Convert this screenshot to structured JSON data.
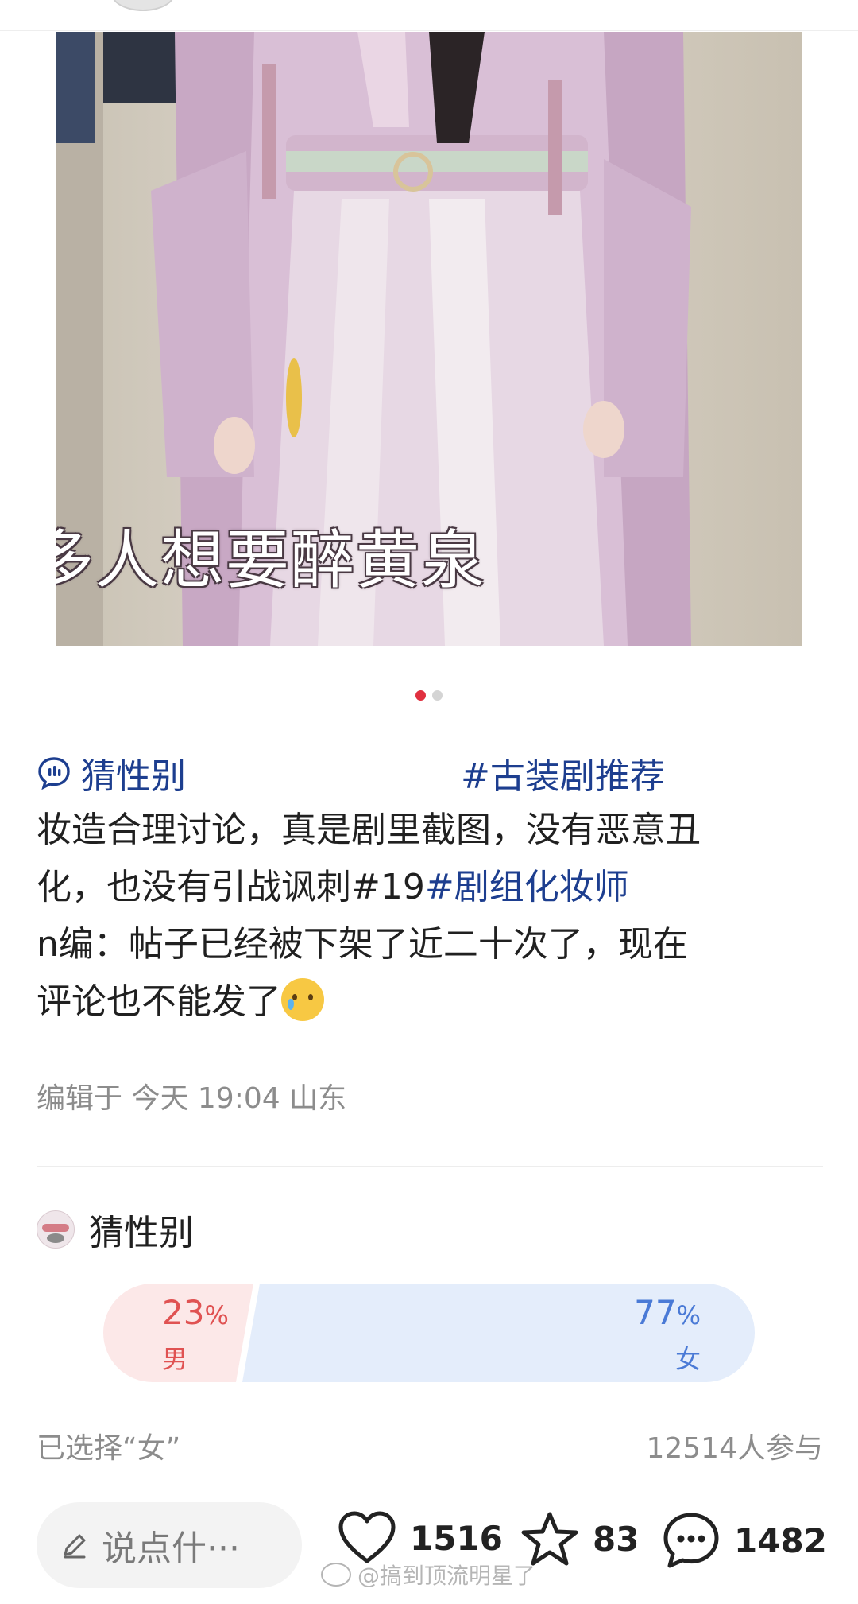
{
  "photo": {
    "caption": "多人想要醉黄泉"
  },
  "carousel": {
    "total": 2,
    "active": 1
  },
  "post": {
    "topic_tag": "猜性别",
    "hash_tag": "#古装剧推荐",
    "line1": "妆造合理讨论，真是剧里截图，没有恶意丑",
    "line2_text": "化，也没有引战讽刺#19",
    "line2_link": "#剧组化妆师",
    "line3": "n编：帖子已经被下架了近二十次了，现在",
    "line4": "评论也不能发了",
    "edit_meta": "编辑于 今天 19:04 山东"
  },
  "poll": {
    "title": "猜性别",
    "options": [
      {
        "percent": "23",
        "unit": "%",
        "label": "男",
        "share": 0.23,
        "color": "#e05252"
      },
      {
        "percent": "77",
        "unit": "%",
        "label": "女",
        "share": 0.77,
        "color": "#4a7ad6"
      }
    ],
    "selected_text": "已选择“女”",
    "participants": "12514人参与"
  },
  "bottom_bar": {
    "comment_placeholder": "说点什···",
    "likes": "1516",
    "favorites": "83",
    "comments": "1482"
  },
  "watermark": "@搞到顶流明星了",
  "icons": [
    "pen-icon",
    "heart-icon",
    "star-icon",
    "comment-icon",
    "chat-bubble-icon",
    "emoji-icon"
  ]
}
